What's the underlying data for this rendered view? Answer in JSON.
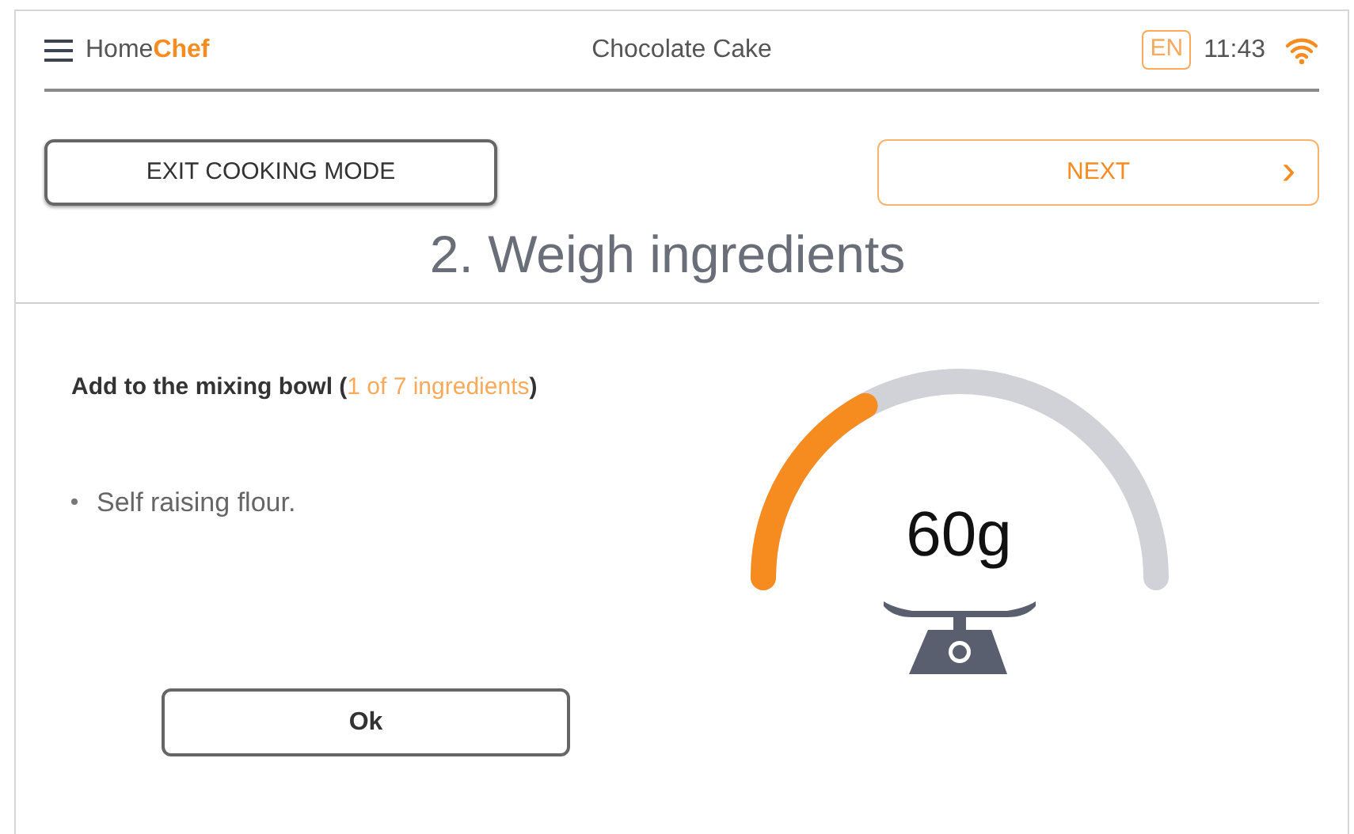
{
  "header": {
    "brand": "Home**Chef**",
    "recipe": "Chocolate Cake",
    "language": "EN",
    "time": "11:43"
  },
  "buttons": {
    "exit": "EXIT COOKING MODE",
    "next": "NEXT",
    "next_arrow": "›"
  },
  "step_title": "2. Weigh ingredients",
  "instruction": {
    "text": "Add to the mixing bowl (",
    "progress": "1 of 7 ingredients",
    "close": ")"
  },
  "ingredients": [
    "Self raising flour."
  ],
  "ok_button": "Ok",
  "scale": {
    "reading": "60g"
  }
}
